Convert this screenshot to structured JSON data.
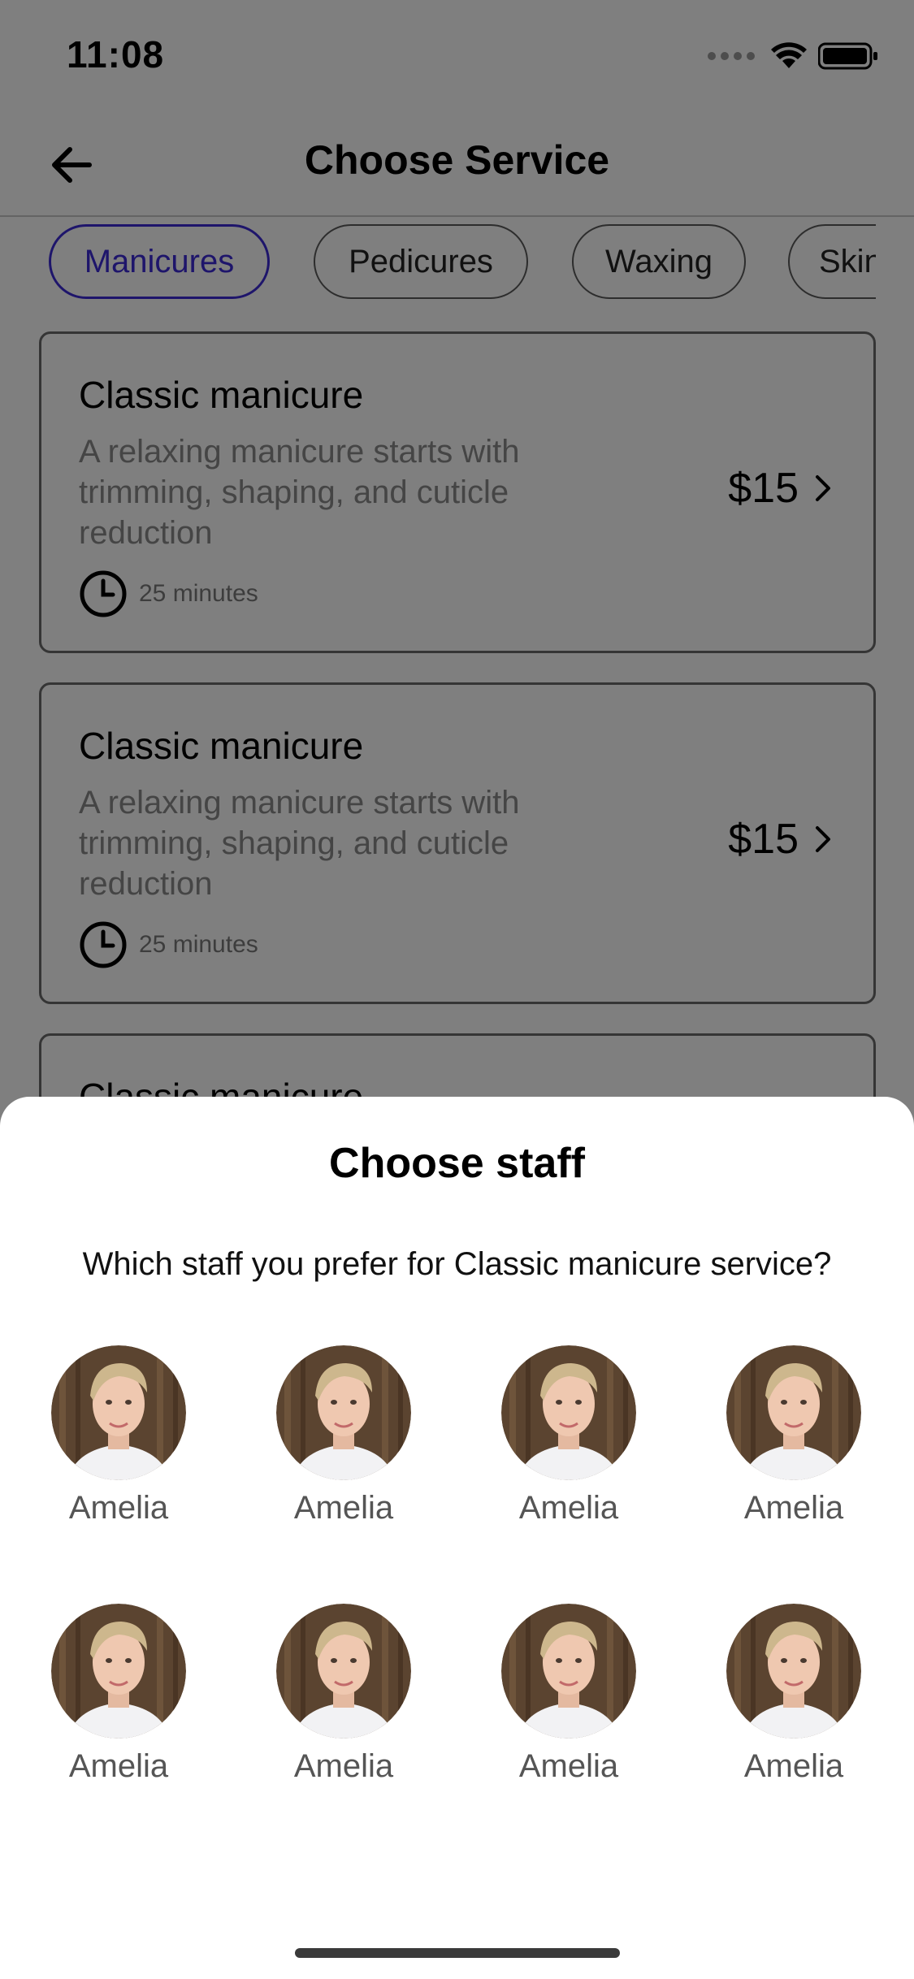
{
  "status_bar": {
    "time": "11:08"
  },
  "header": {
    "title": "Choose Service"
  },
  "categories": [
    {
      "label": "Manicures",
      "active": true
    },
    {
      "label": "Pedicures",
      "active": false
    },
    {
      "label": "Waxing",
      "active": false
    },
    {
      "label": "Skin",
      "active": false
    }
  ],
  "services": [
    {
      "title": "Classic manicure",
      "description": "A relaxing manicure starts with trimming, shaping, and cuticle reduction",
      "duration": "25 minutes",
      "price": "$15"
    },
    {
      "title": "Classic manicure",
      "description": "A relaxing manicure starts with trimming, shaping, and cuticle reduction",
      "duration": "25 minutes",
      "price": "$15"
    },
    {
      "title": "Classic manicure",
      "description": "",
      "duration": "",
      "price": ""
    }
  ],
  "sheet": {
    "title": "Choose staff",
    "question": "Which staff you prefer for Classic manicure service?",
    "staff": [
      {
        "name": "Amelia"
      },
      {
        "name": "Amelia"
      },
      {
        "name": "Amelia"
      },
      {
        "name": "Amelia"
      },
      {
        "name": "Amelia"
      },
      {
        "name": "Amelia"
      },
      {
        "name": "Amelia"
      },
      {
        "name": "Amelia"
      }
    ]
  },
  "icons": {
    "back": "arrow-left-icon",
    "clock": "clock-icon",
    "chevron": "chevron-right-icon",
    "avatar": "user-photo"
  },
  "colors": {
    "accent": "#3d2bd6",
    "overlay": "rgba(0,0,0,0.5)"
  }
}
